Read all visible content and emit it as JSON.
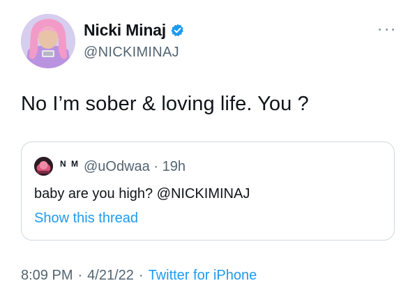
{
  "author": {
    "display_name": "Nicki Minaj",
    "handle": "@NICKIMINAJ",
    "verified": true
  },
  "tweet": {
    "text": "No I’m sober & loving life. You ?"
  },
  "quoted_tweet": {
    "display_name": "N M",
    "handle": "@uOdwaa",
    "separator": "·",
    "age": "19h",
    "text": "baby are you high? @NICKIMINAJ",
    "show_thread_label": "Show this thread"
  },
  "footer": {
    "time": "8:09 PM",
    "separator": "·",
    "date": "4/21/22",
    "source": "Twitter for iPhone"
  },
  "colors": {
    "link": "#1d9bf0",
    "secondary_text": "#536471",
    "border": "#cfd9de",
    "verified_badge": "#1d9bf0"
  },
  "icons": [
    "verified-badge-icon",
    "more-options-icon"
  ]
}
